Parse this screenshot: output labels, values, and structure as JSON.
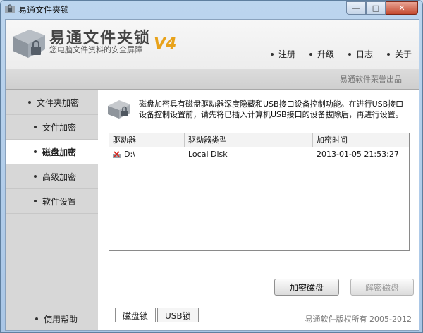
{
  "window": {
    "title": "易通文件夹锁",
    "controls": {
      "minimize": "—",
      "maximize": "□",
      "close": "✕"
    }
  },
  "header": {
    "app_name": "易通文件夹锁",
    "tagline": "您电脑文件资料的安全屏障",
    "version": "V4",
    "brand": "易通软件荣誉出品",
    "nav": [
      {
        "label": "注册"
      },
      {
        "label": "升级"
      },
      {
        "label": "日志"
      },
      {
        "label": "关于"
      }
    ]
  },
  "sidebar": {
    "items": [
      {
        "label": "文件夹加密"
      },
      {
        "label": "文件加密"
      },
      {
        "label": "磁盘加密"
      },
      {
        "label": "高级加密"
      },
      {
        "label": "软件设置"
      }
    ],
    "active": "磁盘加密",
    "help_label": "使用帮助"
  },
  "main": {
    "description": "磁盘加密具有磁盘驱动器深度隐藏和USB接口设备控制功能。在进行USB接口设备控制设置前，请先将已插入计算机USB接口的设备拔除后，再进行设置。",
    "table": {
      "columns": [
        "驱动器",
        "驱动器类型",
        "加密时间"
      ],
      "rows": [
        {
          "drive": "D:\\",
          "type": "Local Disk",
          "time": "2013-01-05 21:53:27"
        }
      ]
    },
    "buttons": {
      "encrypt": "加密磁盘",
      "decrypt": "解密磁盘"
    },
    "tabs": [
      {
        "label": "磁盘锁"
      },
      {
        "label": "USB锁"
      }
    ]
  },
  "footer": {
    "copyright": "易通软件版权所有 2005-2012"
  },
  "colors": {
    "accent_version": "#e8a21a",
    "sidebar_bg": "#d7d7d7",
    "titlebar": "#bcd5ee"
  }
}
